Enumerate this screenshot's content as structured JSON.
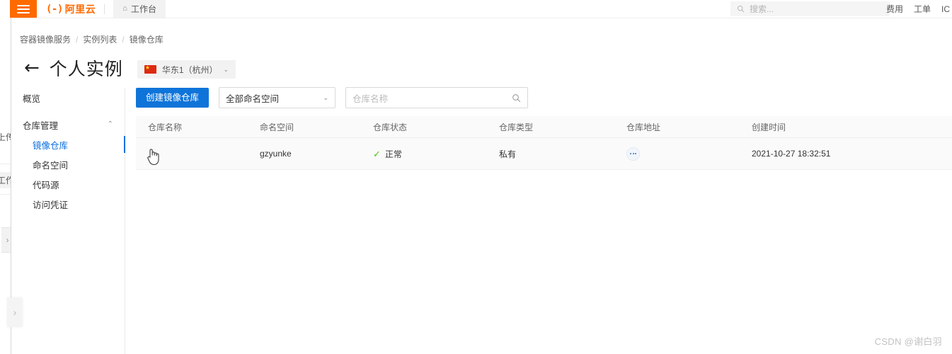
{
  "header": {
    "menu_icon": "hamburger-icon",
    "logo_mark": "(-)",
    "logo_text": "阿里云",
    "workbench_label": "工作台",
    "home_icon": "⌂",
    "search_placeholder": "搜索...",
    "nav_items": [
      {
        "label": "费用"
      },
      {
        "label": "工单"
      },
      {
        "label": "IC"
      }
    ],
    "accent_orange": "#ff6a00"
  },
  "breadcrumb": {
    "items": [
      {
        "label": "容器镜像服务"
      },
      {
        "label": "实例列表"
      },
      {
        "label": "镜像仓库"
      }
    ],
    "separator": "/"
  },
  "page": {
    "back_arrow": "←",
    "title": "个人实例",
    "region": {
      "label": "华东1（杭州）",
      "chevron": "⌄"
    }
  },
  "sidebar": {
    "items": [
      {
        "label": "概览",
        "type": "item"
      },
      {
        "label": "仓库管理",
        "type": "group",
        "caret": "⌃"
      },
      {
        "label": "镜像仓库",
        "type": "sub",
        "active": true
      },
      {
        "label": "命名空间",
        "type": "sub"
      },
      {
        "label": "代码源",
        "type": "sub"
      },
      {
        "label": "访问凭证",
        "type": "sub"
      }
    ],
    "active_color": "#0c6fe0"
  },
  "toolbar": {
    "create_button": "创建镜像仓库",
    "namespace_select": "全部命名空间",
    "namespace_chevron": "⌄",
    "search_placeholder": "仓库名称"
  },
  "table": {
    "columns": [
      "仓库名称",
      "命名空间",
      "仓库状态",
      "仓库类型",
      "仓库地址",
      "创建时间"
    ],
    "rows": [
      {
        "name": "",
        "namespace": "gzyunke",
        "status": "正常",
        "status_icon": "✓",
        "type": "私有",
        "address_icon": "ellipsis-icon",
        "created_at": "2021-10-27 18:32:51"
      }
    ],
    "status_color": "#52c41a"
  },
  "edge_panel": {
    "text_top": "上传",
    "text_bottom": "工作",
    "expand_chevron": "›"
  },
  "watermark": {
    "text": "CSDN @谢白羽"
  }
}
